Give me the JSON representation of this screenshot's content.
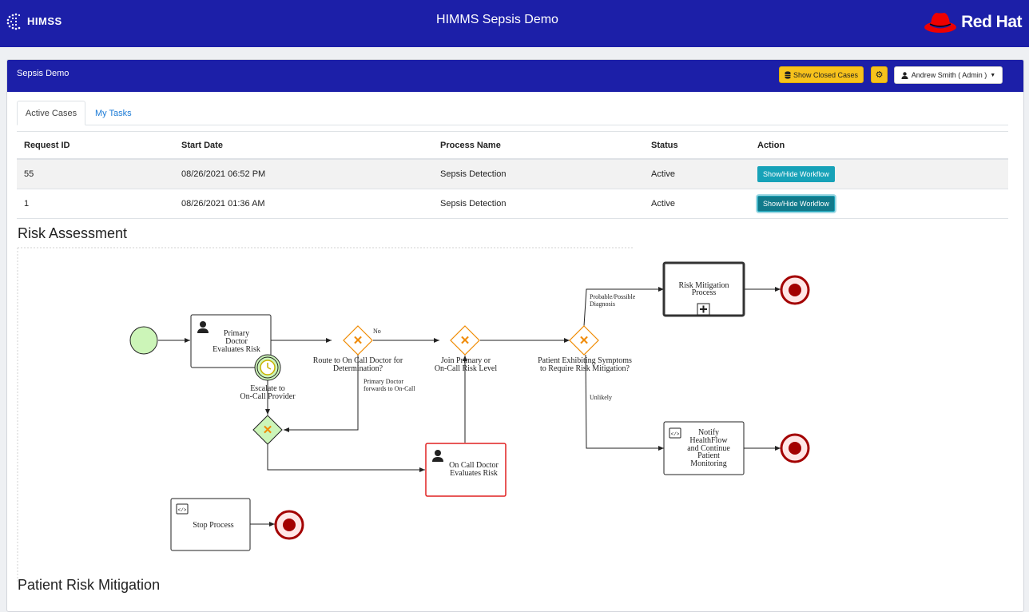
{
  "header": {
    "logo_text": "HIMSS",
    "title": "HIMMS Sepsis Demo",
    "brand_text": "Red Hat"
  },
  "card": {
    "title": "Sepsis Demo",
    "show_closed_label": "Show Closed Cases",
    "settings_icon": "gear-icon",
    "user_label": "Andrew Smith ( Admin )"
  },
  "tabs": [
    {
      "label": "Active Cases",
      "active": true
    },
    {
      "label": "My Tasks",
      "active": false
    }
  ],
  "table": {
    "columns": [
      "Request ID",
      "Start Date",
      "Process Name",
      "Status",
      "Action"
    ],
    "rows": [
      {
        "id": "55",
        "start": "08/26/2021 06:52 PM",
        "process": "Sepsis Detection",
        "status": "Active",
        "action": "Show/Hide Workflow"
      },
      {
        "id": "1",
        "start": "08/26/2021 01:36 AM",
        "process": "Sepsis Detection",
        "status": "Active",
        "action": "Show/Hide Workflow"
      }
    ]
  },
  "sections": {
    "risk_assessment": "Risk Assessment",
    "patient_risk_mitigation": "Patient Risk Mitigation"
  },
  "workflow": {
    "task_primary": [
      "Primary",
      "Doctor",
      "Evaluates Risk"
    ],
    "timer_label": [
      "Escalate to",
      "On-Call Provider"
    ],
    "gateway_route": [
      "Route to On Call Doctor for",
      "Determination?"
    ],
    "flow_no": "No",
    "flow_forward": [
      "Primary Doctor",
      "forwards to On-Call"
    ],
    "gateway_join": [
      "Join Primary or",
      "On-Call Risk Level"
    ],
    "gateway_symptoms": [
      "Patient Exhibiting Symptoms",
      "to Require Risk Mitigation?"
    ],
    "flow_probable": [
      "Probable/Possible",
      "Diagnosis"
    ],
    "flow_unlikely": "Unlikely",
    "subprocess": [
      "Risk Mitigation",
      "Process"
    ],
    "task_notify": [
      "Notify",
      "HealthFlow",
      "and Continue",
      "Patient",
      "Monitoring"
    ],
    "task_oncall": [
      "On Call Doctor",
      "Evaluates Risk"
    ],
    "task_stop": "Stop Process"
  },
  "colors": {
    "primary_blue": "#1c1fa8",
    "warning_yellow": "#f7c21c",
    "info_teal": "#17a2b8",
    "gateway_orange": "#f08a00",
    "end_red": "#a30000"
  }
}
